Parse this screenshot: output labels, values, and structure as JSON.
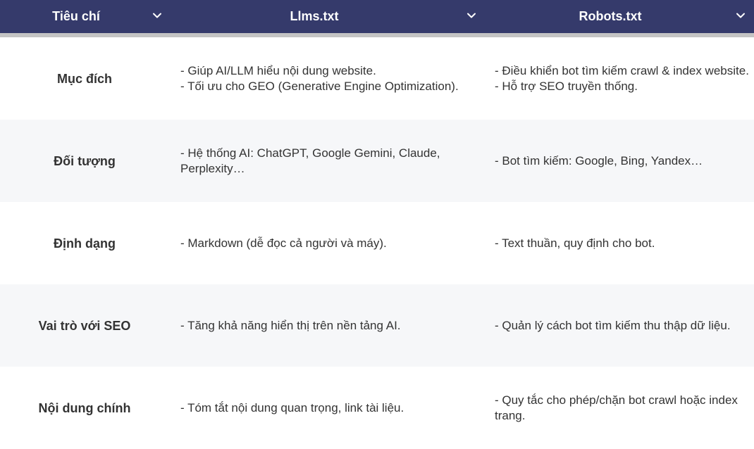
{
  "table": {
    "headers": [
      {
        "label": "Tiêu chí"
      },
      {
        "label": "Llms.txt"
      },
      {
        "label": "Robots.txt"
      }
    ],
    "rows": [
      {
        "criterion": "Mục đích",
        "llms": [
          "- Giúp AI/LLM hiểu nội dung website.",
          "- Tối ưu cho GEO (Generative Engine Optimization)."
        ],
        "robots": [
          "- Điều khiển bot tìm kiếm crawl & index website.",
          "- Hỗ trợ SEO truyền thống."
        ]
      },
      {
        "criterion": "Đối tượng",
        "llms": [
          "- Hệ thống AI: ChatGPT, Google Gemini, Claude, Perplexity…"
        ],
        "robots": [
          "- Bot tìm kiếm: Google, Bing, Yandex…"
        ]
      },
      {
        "criterion": "Định dạng",
        "llms": [
          "- Markdown (dễ đọc cả người và máy)."
        ],
        "robots": [
          "- Text thuần, quy định cho bot."
        ]
      },
      {
        "criterion": "Vai trò với SEO",
        "llms": [
          "- Tăng khả năng hiển thị trên nền tảng AI."
        ],
        "robots": [
          "- Quản lý cách bot tìm kiếm thu thập dữ liệu."
        ]
      },
      {
        "criterion": "Nội dung chính",
        "llms": [
          "- Tóm tắt nội dung quan trọng, link tài liệu."
        ],
        "robots": [
          "- Quy tắc cho phép/chặn bot crawl hoặc index trang."
        ]
      }
    ]
  },
  "icons": {
    "sort": "chevron-down-icon"
  },
  "colors": {
    "header_bg": "#353a6b",
    "header_rule": "#c4c4c4",
    "row_alt": "#f6f7f9",
    "text": "#333333"
  }
}
